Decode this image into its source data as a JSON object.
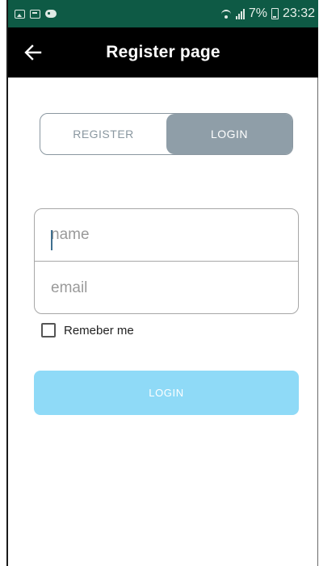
{
  "status_bar": {
    "battery_percent": "7%",
    "time": "23:32",
    "left_icons": [
      "image-icon",
      "message-icon",
      "game-controller-icon"
    ],
    "right_icons": [
      "wifi-icon",
      "signal-icon",
      "battery-icon"
    ],
    "background_color": "#0e5a45"
  },
  "app_bar": {
    "title": "Register page",
    "back_icon": "arrow-left-icon",
    "background_color": "#000000"
  },
  "segmented": {
    "register_label": "REGISTER",
    "login_label": "LOGIN",
    "selected": "LOGIN",
    "active_color": "#8f9ea8"
  },
  "form": {
    "name_placeholder": "name",
    "name_value": "",
    "email_placeholder": "email",
    "email_value": "",
    "remember_label": "Remeber me",
    "remember_checked": false
  },
  "login_button": {
    "label": "LOGIN",
    "color": "#8fdaf7"
  }
}
